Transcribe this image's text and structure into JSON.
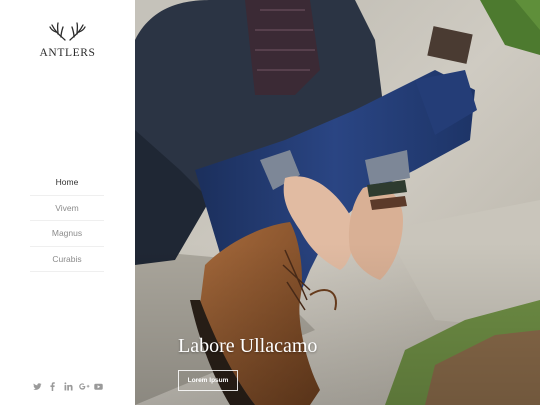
{
  "brand": {
    "name": "ANTLERS",
    "logo_icon": "antlers-icon"
  },
  "nav": {
    "items": [
      {
        "label": "Home",
        "active": true
      },
      {
        "label": "Vivem",
        "active": false
      },
      {
        "label": "Magnus",
        "active": false
      },
      {
        "label": "Curabis",
        "active": false
      }
    ]
  },
  "social": {
    "icons": [
      "twitter-icon",
      "facebook-icon",
      "linkedin-icon",
      "google-plus-icon",
      "youtube-icon"
    ],
    "color": "#9a9a9a"
  },
  "hero": {
    "title": "Labore Ullacamo",
    "button_label": "Lorem Ipsum"
  },
  "colors": {
    "sidebar_bg": "#ffffff",
    "text_dark": "#2b2b2b",
    "nav_text": "#8b8b8b",
    "divider": "#efefef"
  }
}
